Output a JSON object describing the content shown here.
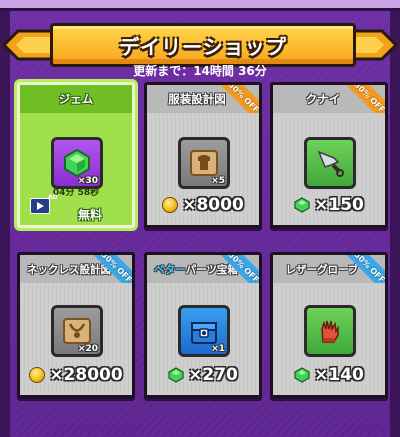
{
  "header": {
    "title": "デイリーショップ",
    "refresh_text": "更新まで：14時間 36分"
  },
  "cards": [
    {
      "name": "ジェム",
      "qty": "×30",
      "timer": "04分 58秒",
      "ad_label": "AD",
      "price": "無料",
      "featured": true
    },
    {
      "name": "服装設計図",
      "qty": "×5",
      "price": "×8000",
      "currency": "coin",
      "badge": "30% OFF",
      "badge_color": "#f39a1c"
    },
    {
      "name": "クナイ",
      "price": "×150",
      "currency": "gem",
      "badge": "30% OFF",
      "badge_color": "#f39a1c"
    },
    {
      "name": "ネックレス設計図",
      "qty": "×20",
      "price": "×28000",
      "currency": "coin",
      "badge": "30% OFF",
      "badge_color": "#3aa7e8"
    },
    {
      "name_accent": "ベター",
      "name_rest": "パーツ宝箱",
      "qty": "×1",
      "price": "×270",
      "currency": "gem",
      "badge": "30% OFF",
      "badge_color": "#3aa7e8"
    },
    {
      "name": "レザーグローブ",
      "price": "×140",
      "currency": "gem",
      "badge": "30% OFF",
      "badge_color": "#3aa7e8"
    }
  ]
}
